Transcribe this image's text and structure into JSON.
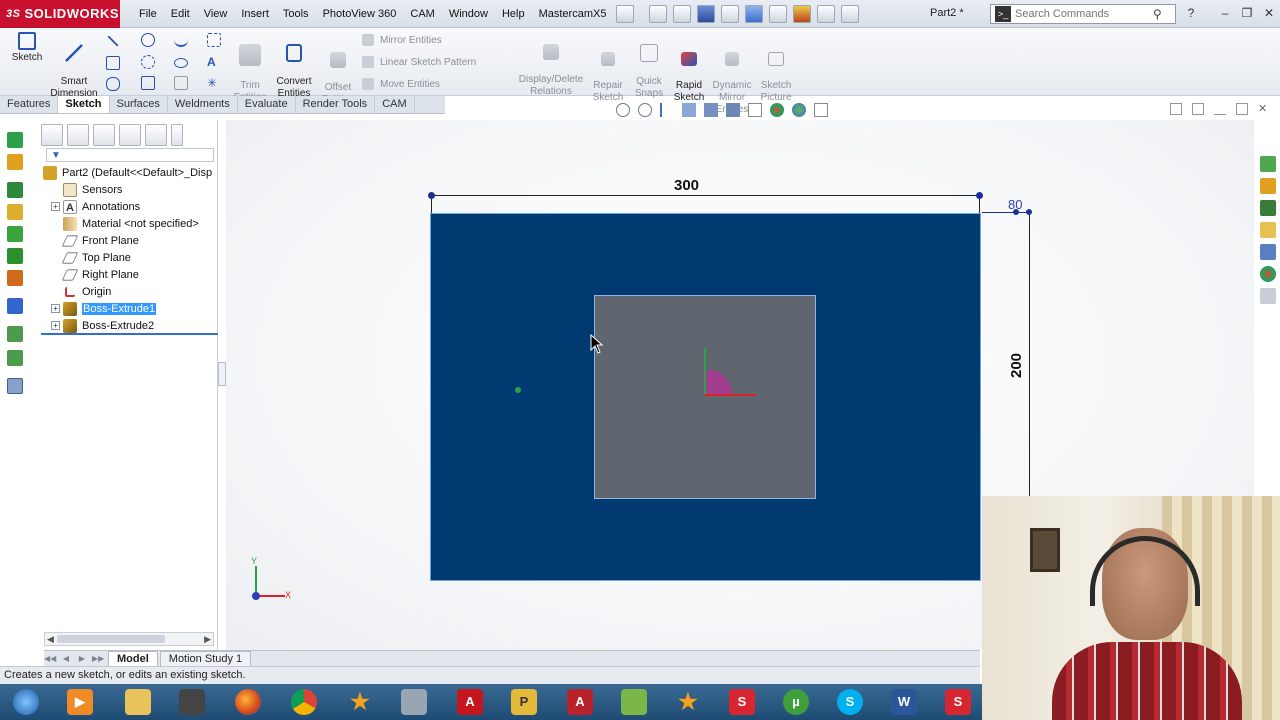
{
  "app": {
    "brand": "SOLIDWORKS",
    "document_title": "Part2 *",
    "menu": [
      "File",
      "Edit",
      "View",
      "Insert",
      "Tools",
      "PhotoView 360",
      "CAM",
      "Window",
      "Help",
      "MastercamX5"
    ],
    "search_placeholder": "Search Commands"
  },
  "ribbon": {
    "sketch": "Sketch",
    "smart_dimension": "Smart\nDimension",
    "trim_entities": "Trim\nEntities",
    "convert_entities": "Convert\nEntities",
    "offset_entities": "Offset\nEntities",
    "mirror_entities": "Mirror Entities",
    "linear_sketch_pattern": "Linear Sketch Pattern",
    "move_entities": "Move Entities",
    "display_delete_relations": "Display/Delete\nRelations",
    "repair_sketch": "Repair\nSketch",
    "quick_snaps": "Quick\nSnaps",
    "rapid_sketch": "Rapid\nSketch",
    "dynamic_mirror_entities": "Dynamic\nMirror\nEntities",
    "sketch_picture": "Sketch\nPicture"
  },
  "tabs": [
    "Features",
    "Sketch",
    "Surfaces",
    "Weldments",
    "Evaluate",
    "Render Tools",
    "CAM"
  ],
  "active_tab": "Sketch",
  "tree": {
    "root": "Part2  (Default<<Default>_Disp",
    "items": [
      {
        "label": "Sensors",
        "expandable": false
      },
      {
        "label": "Annotations",
        "expandable": true
      },
      {
        "label": "Material <not specified>",
        "expandable": false
      },
      {
        "label": "Front Plane",
        "expandable": false
      },
      {
        "label": "Top Plane",
        "expandable": false
      },
      {
        "label": "Right Plane",
        "expandable": false
      },
      {
        "label": "Origin",
        "expandable": false
      },
      {
        "label": "Boss-Extrude1",
        "expandable": true,
        "selected": true
      },
      {
        "label": "Boss-Extrude2",
        "expandable": true
      }
    ]
  },
  "dimensions": {
    "width": "300",
    "height": "200",
    "depth": "80"
  },
  "triad": {
    "x": "X",
    "y": "Y"
  },
  "bottom_tabs": [
    "Model",
    "Motion Study 1"
  ],
  "status": "Creates a new sketch, or edits an existing sketch.",
  "colors": {
    "part_face": "#003a70",
    "inner_face": "#5f6670",
    "brand_red": "#c8102e",
    "selection": "#3399ff"
  }
}
